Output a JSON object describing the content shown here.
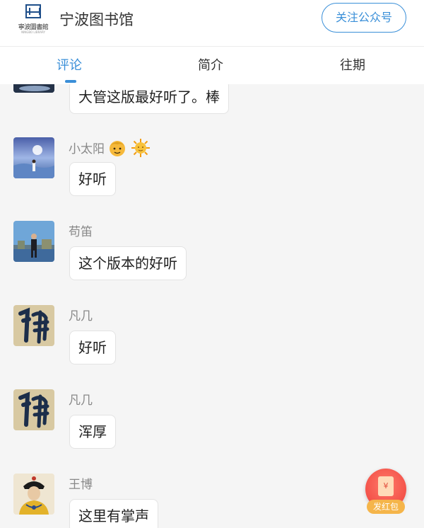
{
  "header": {
    "logo_text": "寧波圖書館",
    "logo_sub": "NINGBO LIBRARY",
    "title": "宁波图书馆",
    "follow_label": "关注公众号"
  },
  "tabs": [
    {
      "label": "评论",
      "active": true
    },
    {
      "label": "简介",
      "active": false
    },
    {
      "label": "往期",
      "active": false
    }
  ],
  "comments": [
    {
      "user": "",
      "text": "大管这版最好听了。棒"
    },
    {
      "user": "小太阳",
      "emojis": [
        "child-emoji",
        "sun-emoji"
      ],
      "text": "好听"
    },
    {
      "user": "苟笛",
      "text": "这个版本的好听"
    },
    {
      "user": "凡几",
      "text": "好听"
    },
    {
      "user": "凡几",
      "text": "浑厚"
    },
    {
      "user": "王博",
      "text": "这里有掌声"
    }
  ],
  "red_packet": {
    "symbol": "¥",
    "label": "发红包"
  },
  "colors": {
    "accent": "#3a8fd8",
    "background": "#f5f5f5",
    "red_packet": "#ee3f3a",
    "red_packet_label": "#f5b54a"
  }
}
